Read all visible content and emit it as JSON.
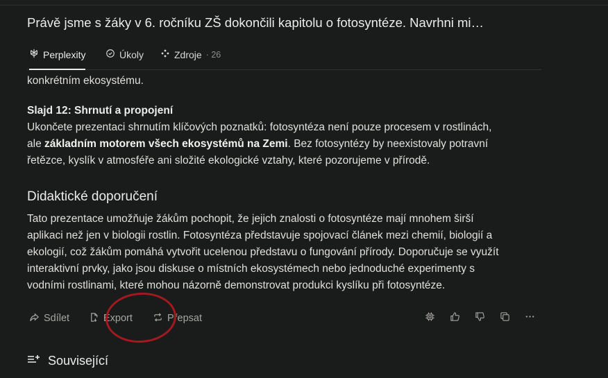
{
  "query": {
    "title": "Právě jsme s žáky v 6. ročníku ZŠ dokončili kapitolu o fotosyntéze. Navrhni mi…"
  },
  "tabs": [
    {
      "label": "Perplexity",
      "icon": "perplexity-logo-icon",
      "active": true
    },
    {
      "label": "Úkoly",
      "icon": "check-circle-icon",
      "active": false
    },
    {
      "label": "Zdroje",
      "icon": "sources-icon",
      "count": "· 26",
      "active": false
    }
  ],
  "article": {
    "lead_fragment": "konkrétním ekosystému.",
    "slide12": {
      "heading": "Slajd 12: Shrnutí a propojení",
      "text_before": "Ukončete prezentaci shrnutím klíčových poznatků: fotosyntéza není pouze procesem v rostlinách,",
      "text_line2_start": "ale ",
      "bold": "základním motorem všech ekosystémů na Zemi",
      "text_after": ". Bez fotosyntézy by neexistovaly potravní",
      "text_line3": "řetězce, kyslík v atmosféře ani složité ekologické vztahy, které pozorujeme v přírodě."
    },
    "didactic": {
      "heading": "Didaktické doporučení",
      "lines": [
        "Tato prezentace umožňuje žákům pochopit, že jejich znalosti o fotosyntéze mají mnohem širší",
        "aplikaci než jen v biologii rostlin. Fotosyntéza představuje spojovací článek mezi chemií, biologií a",
        "ekologií, což žákům pomáhá vytvořit ucelenou představu o fungování přírody. Doporučuje se využít",
        "interaktivní prvky, jako jsou diskuse o místních ekosystémech nebo jednoduché experimenty s",
        "vodními rostlinami, které mohou názorně demonstrovat produkci kyslíku při fotosyntéze."
      ]
    }
  },
  "actions": {
    "share_label": "Sdílet",
    "export_label": "Export",
    "rewrite_label": "Přepsat"
  },
  "related": {
    "label": "Související"
  },
  "colors": {
    "background": "#1a1b1b",
    "text": "#e6e6e3",
    "muted": "#a5a5a1",
    "annotation": "#a11a1f"
  }
}
